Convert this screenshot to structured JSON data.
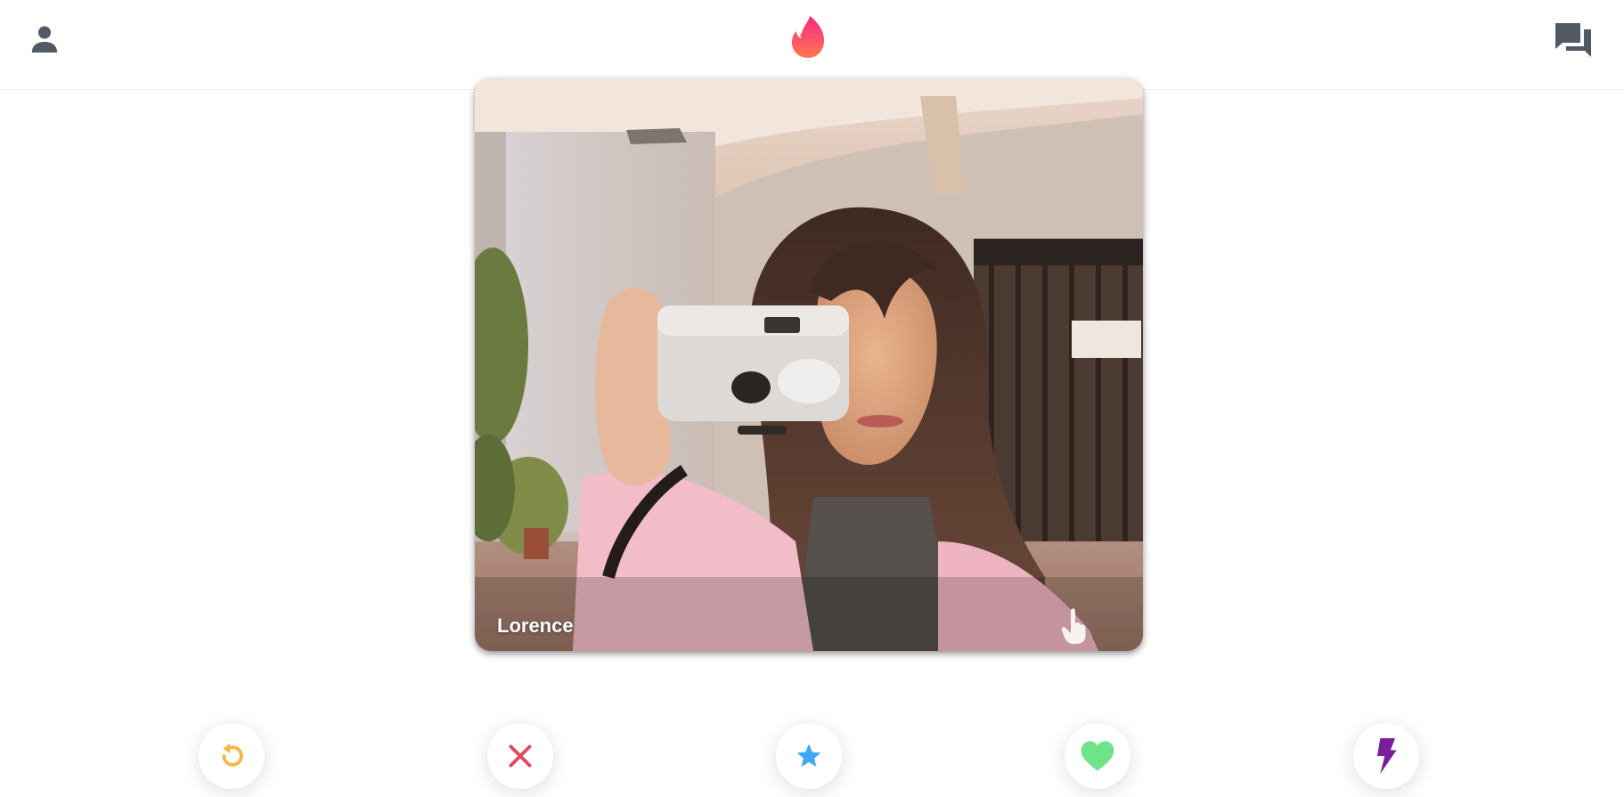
{
  "header": {
    "profile_icon": "person-icon",
    "logo_icon": "flame-logo-icon",
    "messages_icon": "chat-bubbles-icon"
  },
  "card": {
    "name": "Lorence",
    "tap_icon": "tap-hand-icon"
  },
  "actions": [
    {
      "name": "rewind-button",
      "icon": "rewind-icon",
      "color": "#f5b748"
    },
    {
      "name": "nope-button",
      "icon": "x-icon",
      "color": "#e2495b"
    },
    {
      "name": "super-like-button",
      "icon": "star-icon",
      "color": "#3fa9f5"
    },
    {
      "name": "like-button",
      "icon": "heart-icon",
      "color": "#6fe38a"
    },
    {
      "name": "boost-button",
      "icon": "lightning-icon",
      "color": "#7a1e9e"
    }
  ],
  "colors": {
    "brand_gradient_start": "#fd267d",
    "brand_gradient_end": "#ff7854",
    "icon_gray": "#505965"
  }
}
